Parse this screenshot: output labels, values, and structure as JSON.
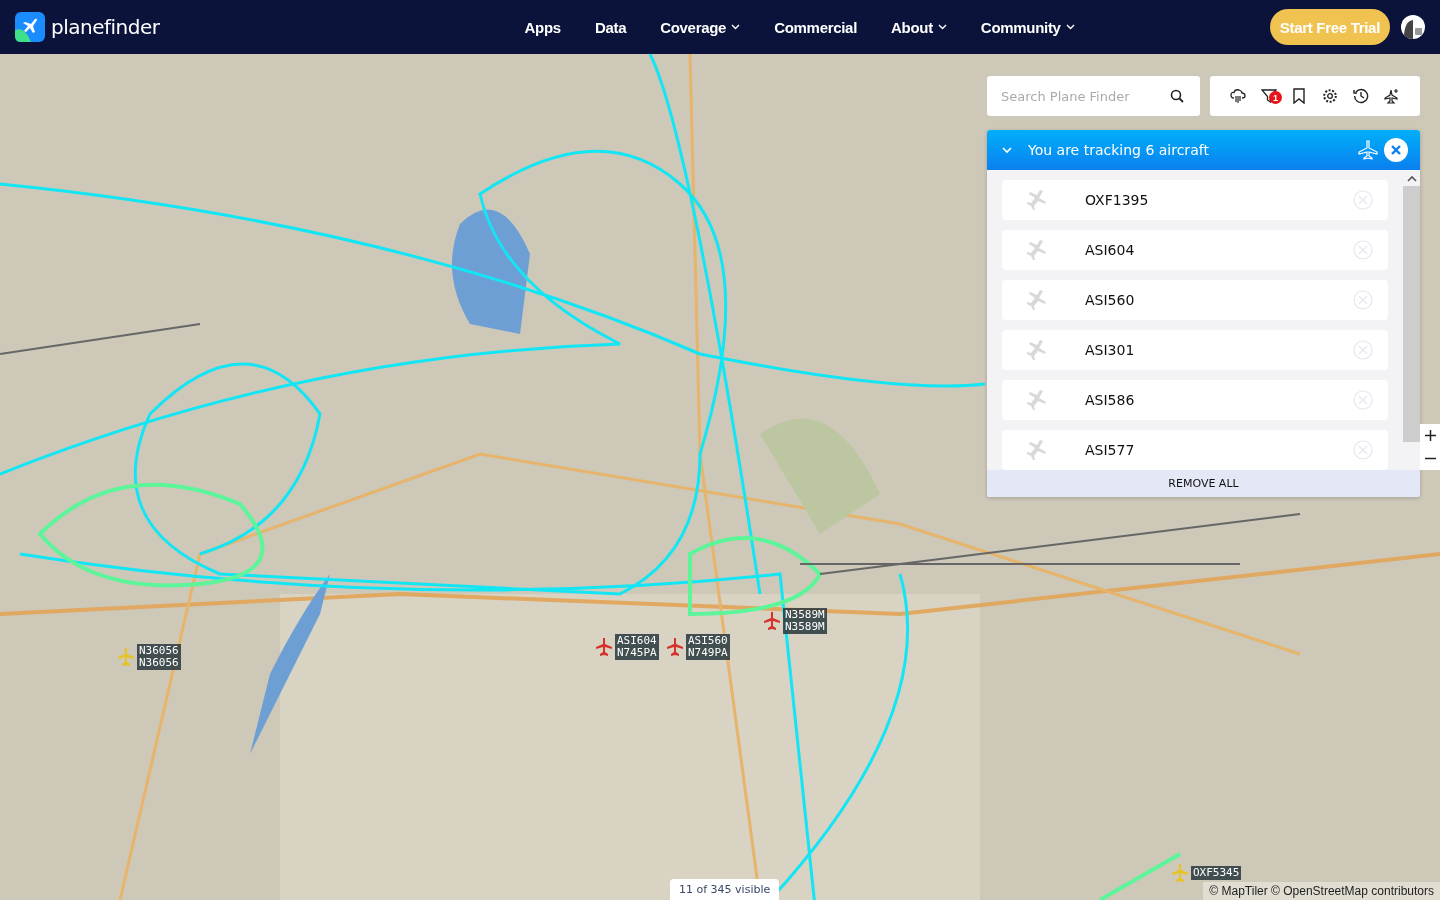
{
  "header": {
    "logo": "planefinder",
    "nav": [
      {
        "label": "Apps",
        "dropdown": false
      },
      {
        "label": "Data",
        "dropdown": false
      },
      {
        "label": "Coverage",
        "dropdown": true
      },
      {
        "label": "Commercial",
        "dropdown": false
      },
      {
        "label": "About",
        "dropdown": true
      },
      {
        "label": "Community",
        "dropdown": true
      }
    ],
    "cta": "Start Free Trial"
  },
  "search": {
    "placeholder": "Search Plane Finder"
  },
  "toolbar": {
    "filter_badge": "1"
  },
  "tracking": {
    "title": "You are tracking 6 aircraft",
    "expanded": true,
    "items": [
      {
        "callsign": "OXF1395"
      },
      {
        "callsign": "ASI604"
      },
      {
        "callsign": "ASI560"
      },
      {
        "callsign": "ASI301"
      },
      {
        "callsign": "ASI586"
      },
      {
        "callsign": "ASI577"
      }
    ],
    "remove_all": "REMOVE ALL"
  },
  "aircraft": [
    {
      "lines": [
        "N36056",
        "N36056"
      ],
      "color": "#e8c21e"
    },
    {
      "lines": [
        "ASI604",
        "N745PA"
      ],
      "color": "#d6312a"
    },
    {
      "lines": [
        "ASI560",
        "N749PA"
      ],
      "color": "#d6312a"
    },
    {
      "lines": [
        "N3589M",
        "N3589M"
      ],
      "color": "#d6312a"
    },
    {
      "lines": [
        "OXF5345"
      ],
      "color": "#e8c21e"
    }
  ],
  "visible_count": "11 of 345 visible",
  "attribution": "© MapTiler © OpenStreetMap contributors"
}
